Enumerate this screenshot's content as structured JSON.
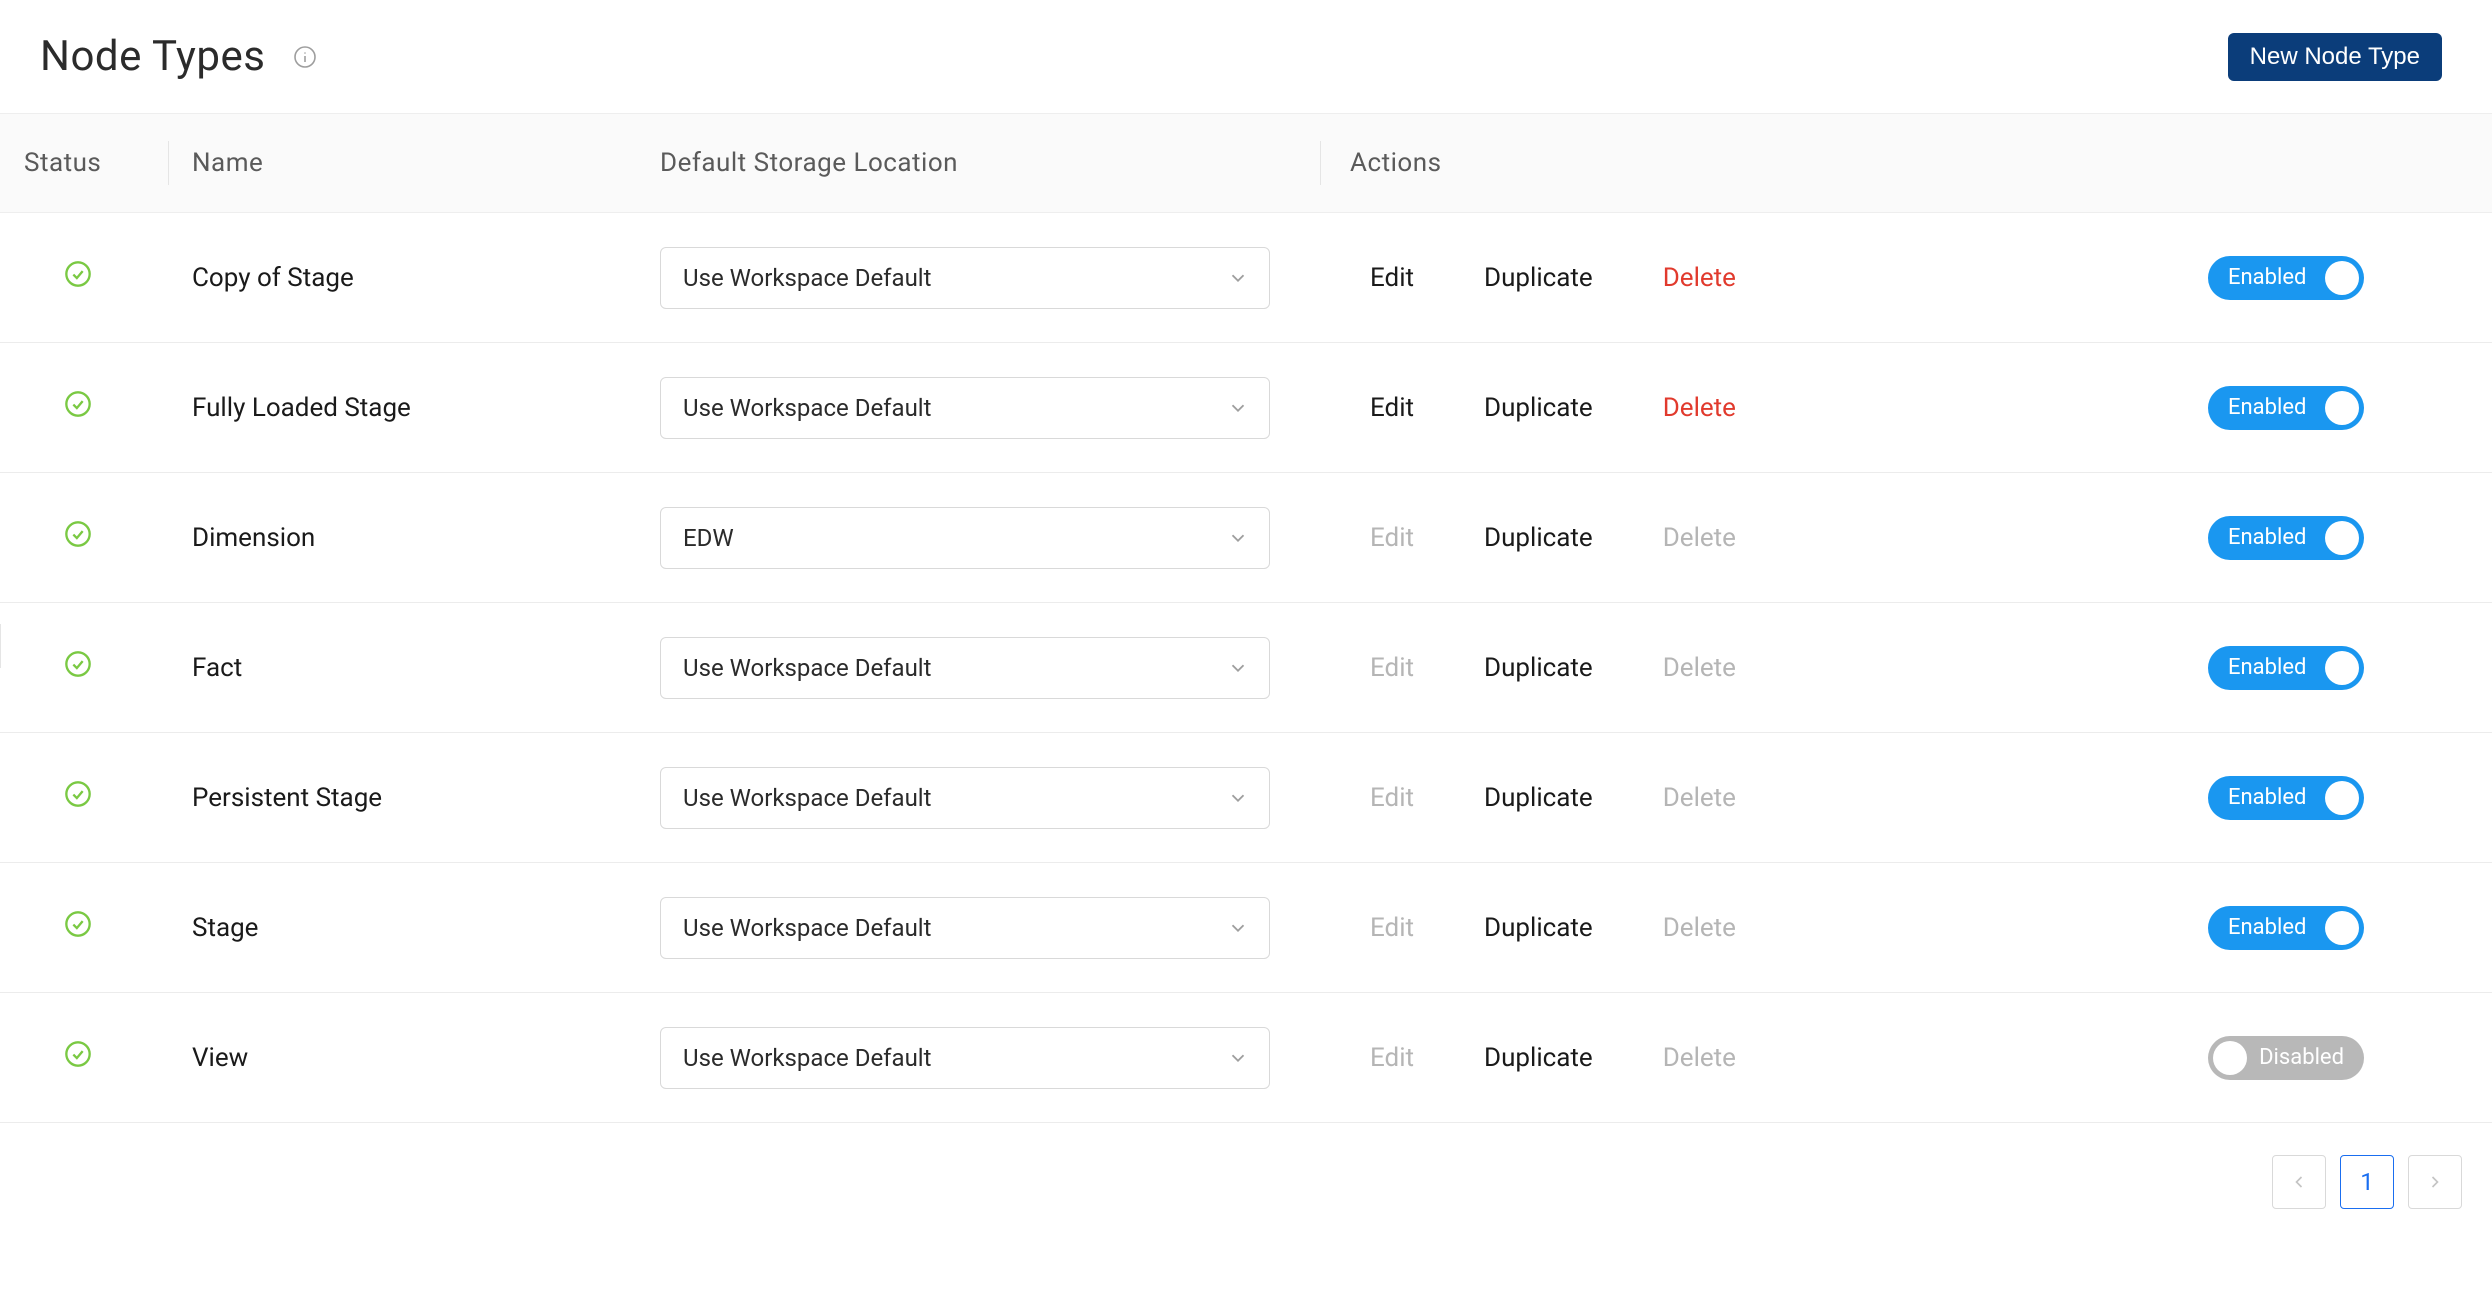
{
  "header": {
    "title": "Node Types",
    "new_button_label": "New Node Type"
  },
  "columns": {
    "status": "Status",
    "name": "Name",
    "storage": "Default Storage Location",
    "actions": "Actions"
  },
  "action_labels": {
    "edit": "Edit",
    "duplicate": "Duplicate",
    "delete": "Delete"
  },
  "toggle_labels": {
    "enabled": "Enabled",
    "disabled": "Disabled"
  },
  "rows": [
    {
      "name": "Copy of Stage",
      "storage": "Use Workspace Default",
      "edit_enabled": true,
      "delete_enabled": true,
      "enabled": true
    },
    {
      "name": "Fully Loaded Stage",
      "storage": "Use Workspace Default",
      "edit_enabled": true,
      "delete_enabled": true,
      "enabled": true
    },
    {
      "name": "Dimension",
      "storage": "EDW",
      "edit_enabled": false,
      "delete_enabled": false,
      "enabled": true
    },
    {
      "name": "Fact",
      "storage": "Use Workspace Default",
      "edit_enabled": false,
      "delete_enabled": false,
      "enabled": true
    },
    {
      "name": "Persistent Stage",
      "storage": "Use Workspace Default",
      "edit_enabled": false,
      "delete_enabled": false,
      "enabled": true
    },
    {
      "name": "Stage",
      "storage": "Use Workspace Default",
      "edit_enabled": false,
      "delete_enabled": false,
      "enabled": true
    },
    {
      "name": "View",
      "storage": "Use Workspace Default",
      "edit_enabled": false,
      "delete_enabled": false,
      "enabled": false
    }
  ],
  "pagination": {
    "current": "1"
  },
  "colors": {
    "primary_button_bg": "#0b3d7a",
    "toggle_on_bg": "#1a97f0",
    "toggle_off_bg": "#b8b8b8",
    "danger_text": "#e13a2d",
    "status_check": "#7ac943"
  }
}
